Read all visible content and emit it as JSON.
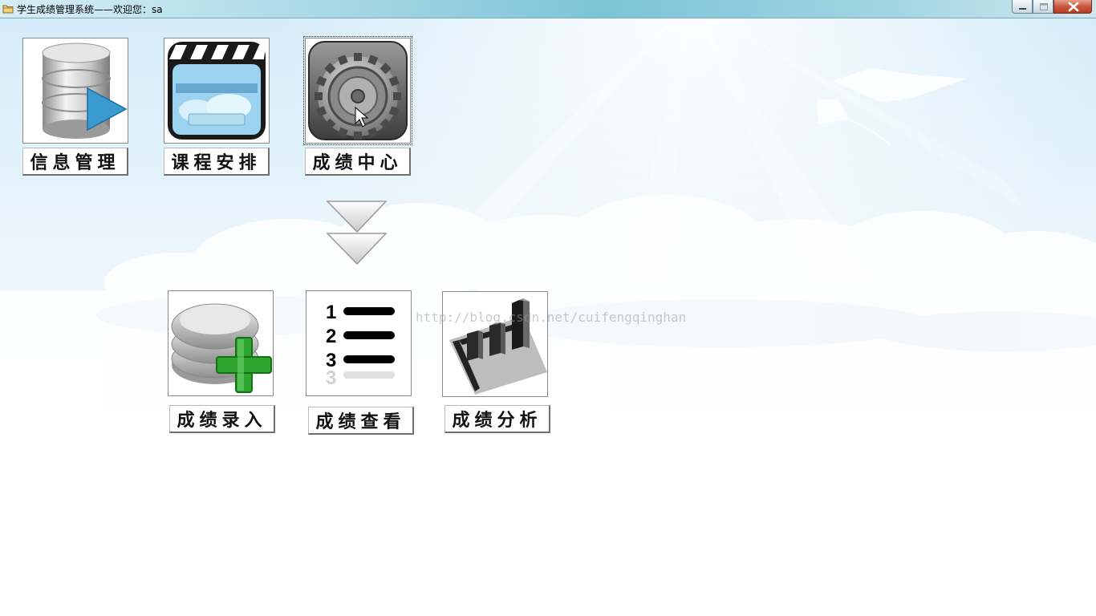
{
  "window": {
    "title": "学生成绩管理系统——欢迎您：sa",
    "controls": [
      "minimize",
      "maximize",
      "close"
    ]
  },
  "top_menu": [
    {
      "label": "信息管理",
      "icon": "database-play-icon"
    },
    {
      "label": "课程安排",
      "icon": "clapperboard-icon"
    },
    {
      "label": "成绩中心",
      "icon": "gear-icon",
      "focused": true
    }
  ],
  "sub_menu": [
    {
      "label": "成绩录入",
      "icon": "database-add-icon"
    },
    {
      "label": "成绩查看",
      "icon": "numbered-list-icon"
    },
    {
      "label": "成绩分析",
      "icon": "bar-chart-3d-icon"
    }
  ],
  "watermark": "http://blog.csdn.net/cuifengqinghan",
  "colors": {
    "sky_top": "#d4ecf8",
    "titlebar": "#7cc4d8",
    "close_button": "#c75a3f"
  }
}
